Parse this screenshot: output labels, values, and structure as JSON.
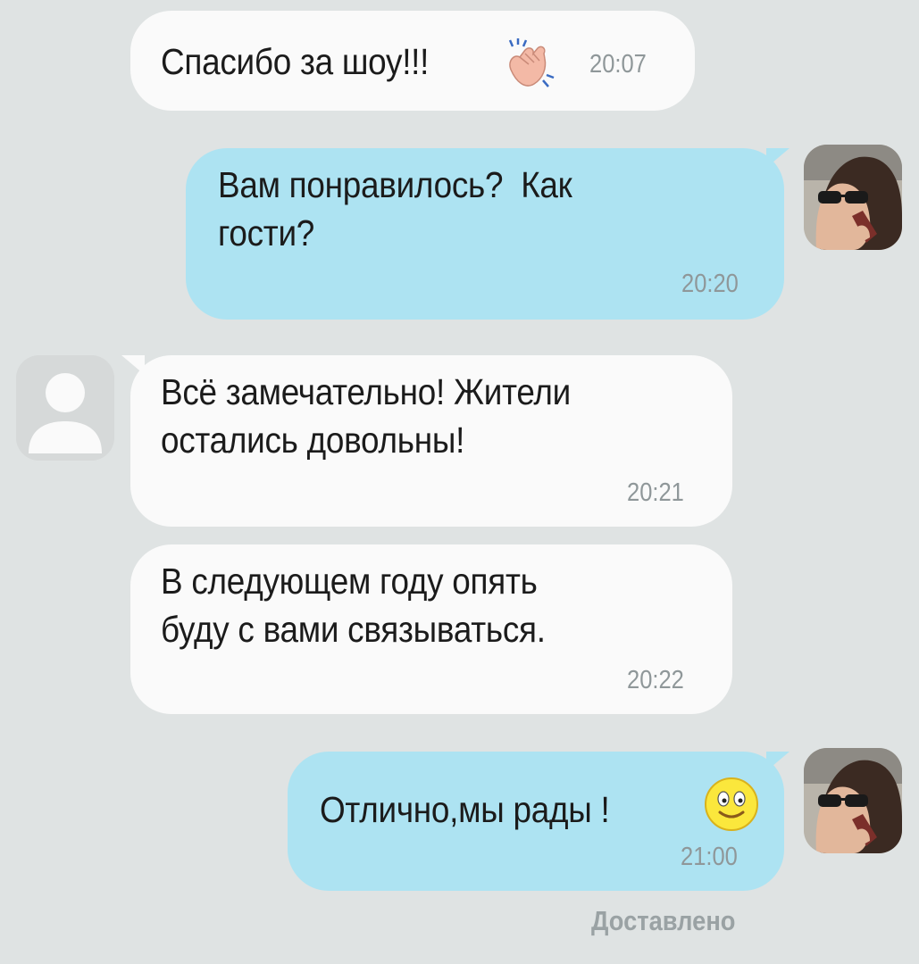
{
  "messages": [
    {
      "direction": "incoming",
      "text": "Спасибо за шоу!!!",
      "time": "20:07",
      "emoji": "clapping-hands-icon"
    },
    {
      "direction": "outgoing",
      "text": "Вам понравилось?  Как\nгости?",
      "time": "20:20"
    },
    {
      "direction": "incoming",
      "text": "Всё замечательно! Жители\nостались довольны!",
      "time": "20:21"
    },
    {
      "direction": "incoming",
      "text": "В следующем году опять\nбуду с вами связываться.",
      "time": "20:22"
    },
    {
      "direction": "outgoing",
      "text": "Отлично,мы рады !",
      "time": "21:00",
      "emoji": "smiley-face-icon"
    }
  ],
  "status": "Доставлено",
  "colors": {
    "background": "#dfe3e3",
    "incoming_bubble": "#fafafa",
    "outgoing_bubble": "#ade3f2",
    "time": "#8f9799"
  }
}
